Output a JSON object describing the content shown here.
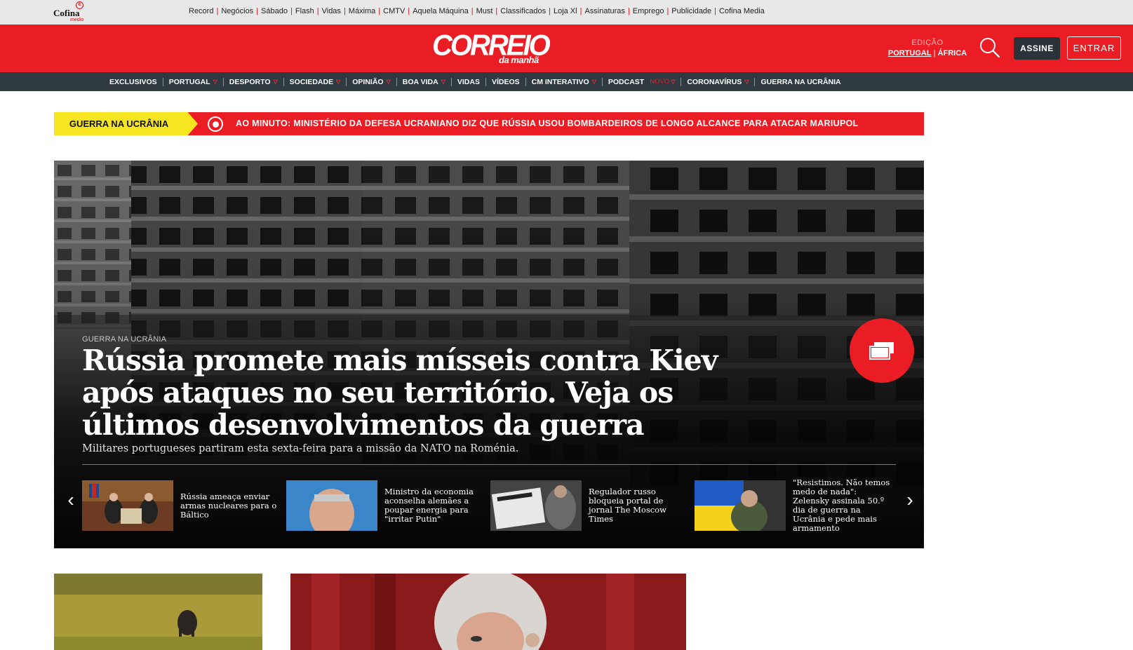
{
  "network": {
    "brand": "Cofina",
    "brand_sub": "media",
    "links": [
      "Record",
      "Negócios",
      "Sábado",
      "Flash",
      "Vidas",
      "Máxima",
      "CMTV",
      "Aquela Máquina",
      "Must",
      "Classificados",
      "Loja Xl",
      "Assinaturas",
      "Emprego",
      "Publicidade",
      "Cofina Media"
    ]
  },
  "header": {
    "logo_main": "CORREIO",
    "logo_sub": "da manhã",
    "edition_label": "EDIÇÃO",
    "edition_portugal": "PORTUGAL",
    "edition_sep": "|",
    "edition_africa": "ÁFRICA",
    "subscribe_label": "ASSINE",
    "login_label": "ENTRAR",
    "accent": "#ea1d25"
  },
  "nav": [
    {
      "label": "EXCLUSIVOS",
      "dropdown": false
    },
    {
      "label": "PORTUGAL",
      "dropdown": true
    },
    {
      "label": "DESPORTO",
      "dropdown": true
    },
    {
      "label": "SOCIEDADE",
      "dropdown": true
    },
    {
      "label": "OPINIÃO",
      "dropdown": true
    },
    {
      "label": "BOA VIDA",
      "dropdown": true
    },
    {
      "label": "VIDAS",
      "dropdown": false
    },
    {
      "label": "VÍDEOS",
      "dropdown": false
    },
    {
      "label": "CM INTERATIVO",
      "dropdown": true
    },
    {
      "label": "PODCAST",
      "dropdown": true,
      "badge": "NOVO"
    },
    {
      "label": "CORONAVÍRUS",
      "dropdown": true
    },
    {
      "label": "GUERRA NA UCRÂNIA",
      "dropdown": false
    }
  ],
  "breaking": {
    "tag": "GUERRA NA UCRÂNIA",
    "text": "AO MINUTO: MINISTÉRIO DA DEFESA UCRANIANO DIZ QUE RÚSSIA USOU BOMBARDEIROS DE LONGO ALCANCE PARA ATACAR MARIUPOL"
  },
  "hero": {
    "kicker": "GUERRA NA UCRÂNIA",
    "title": "Rússia promete mais mísseis contra Kiev após ataques no seu território. Veja os últimos desenvolvimentos da guerra",
    "subtitle": "Militares portugueses partiram esta sexta-feira para a missão da NATO na Roménia.",
    "related": [
      {
        "title": "Rússia ameaça enviar armas nucleares para o Báltico"
      },
      {
        "title": "Ministro da economia aconselha alemães a poupar energia para \"irritar Putin\""
      },
      {
        "title": "Regulador russo bloqueia portal de jornal The Moscow Times"
      },
      {
        "title": "\"Resistimos. Não temos medo de nada\": Zelensky assinala 50.º dia de guerra na Ucrânia e pede mais armamento"
      }
    ]
  }
}
